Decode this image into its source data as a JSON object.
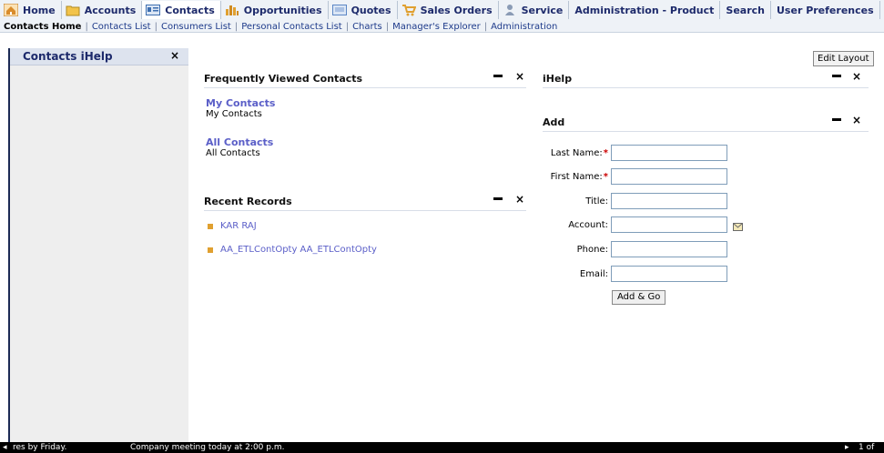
{
  "tabs": [
    {
      "label": "Home",
      "icon": "home-icon",
      "color": "#d98c2c"
    },
    {
      "label": "Accounts",
      "icon": "folder-icon",
      "color": "#f2c34a"
    },
    {
      "label": "Contacts",
      "icon": "contact-card-icon",
      "color": "#3e6fb0"
    },
    {
      "label": "Opportunities",
      "icon": "bar-chart-icon",
      "color": "#e0a030"
    },
    {
      "label": "Quotes",
      "icon": "quote-icon",
      "color": "#5b86c5"
    },
    {
      "label": "Sales Orders",
      "icon": "cart-icon",
      "color": "#e0a030"
    },
    {
      "label": "Service",
      "icon": "person-icon",
      "color": "#8a9bb5"
    },
    {
      "label": "Administration - Product",
      "icon": "",
      "color": ""
    },
    {
      "label": "Search",
      "icon": "",
      "color": ""
    },
    {
      "label": "User Preferences",
      "icon": "",
      "color": ""
    }
  ],
  "subnav": [
    "Contacts Home",
    "Contacts List",
    "Consumers List",
    "Personal Contacts List",
    "Charts",
    "Manager's Explorer",
    "Administration"
  ],
  "left_panel": {
    "title": "Contacts iHelp",
    "close": "×"
  },
  "edit_layout": "Edit Layout",
  "frequent": {
    "title": "Frequently Viewed Contacts",
    "items": [
      {
        "link": "My Contacts",
        "desc": "My Contacts"
      },
      {
        "link": "All Contacts",
        "desc": "All Contacts"
      }
    ]
  },
  "recent": {
    "title": "Recent Records",
    "items": [
      "KAR RAJ",
      "AA_ETLContOpty AA_ETLContOpty"
    ]
  },
  "ihelp": {
    "title": "iHelp"
  },
  "add": {
    "title": "Add",
    "fields": [
      {
        "label": "Last Name:",
        "required": "*",
        "value": ""
      },
      {
        "label": "First Name:",
        "required": "*",
        "value": ""
      },
      {
        "label": "Title:",
        "required": "",
        "value": ""
      },
      {
        "label": "Account:",
        "required": "",
        "value": ""
      },
      {
        "label": "Phone:",
        "required": "",
        "value": ""
      },
      {
        "label": "Email:",
        "required": "",
        "value": ""
      }
    ],
    "button": "Add & Go"
  },
  "controls": {
    "minimize": "—",
    "close": "×"
  },
  "ticker": {
    "text1": "res by Friday.",
    "text2": "Company meeting today at 2:00 p.m.",
    "page": "1 of"
  }
}
